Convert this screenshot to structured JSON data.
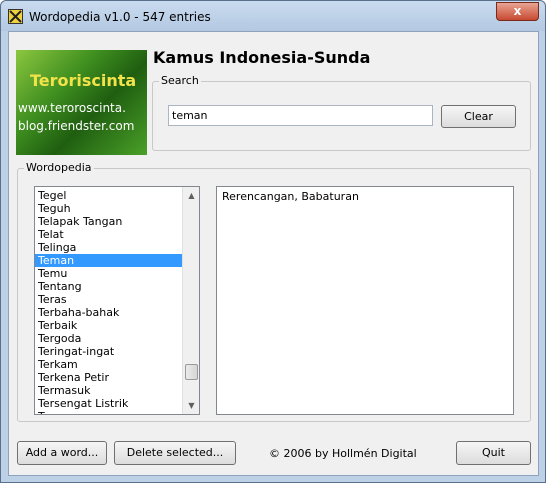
{
  "window": {
    "title": "Wordopedia v1.0 - 547 entries",
    "close_glyph": "x"
  },
  "logo": {
    "line1": "Teroriscinta",
    "line2": "www.teroroscinta.",
    "line3": "blog.friendster.com"
  },
  "heading": "Kamus Indonesia-Sunda",
  "search": {
    "legend": "Search",
    "value": "teman",
    "clear_label": "Clear"
  },
  "wordopedia": {
    "legend": "Wordopedia",
    "items": [
      "Tegel",
      "Teguh",
      "Telapak Tangan",
      "Telat",
      "Telinga",
      "Teman",
      "Temu",
      "Tentang",
      "Teras",
      "Terbaha-bahak",
      "Terbaik",
      "Tergoda",
      "Teringat-ingat",
      "Terkam",
      "Terkena Petir",
      "Termasuk",
      "Tersengat Listrik",
      "Tersenyum"
    ],
    "selected_index": 5,
    "definition": "Rerencangan, Babaturan"
  },
  "footer": {
    "add_label": "Add a word...",
    "delete_label": "Delete selected...",
    "copyright": "© 2006 by Hollmén Digital",
    "quit_label": "Quit"
  },
  "colors": {
    "selection": "#3399ff",
    "close_button": "#c74a32"
  }
}
